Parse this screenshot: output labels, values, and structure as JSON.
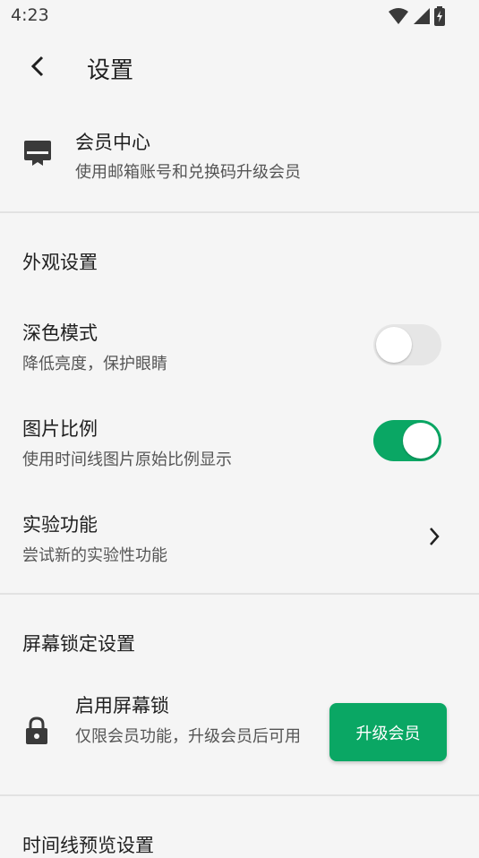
{
  "status_bar": {
    "time": "4:23"
  },
  "app_bar": {
    "title": "设置"
  },
  "member": {
    "title": "会员中心",
    "subtitle": "使用邮箱账号和兑换码升级会员"
  },
  "appearance": {
    "section_title": "外观设置",
    "dark_mode": {
      "title": "深色模式",
      "subtitle": "降低亮度，保护眼睛",
      "enabled": false
    },
    "image_ratio": {
      "title": "图片比例",
      "subtitle": "使用时间线图片原始比例显示",
      "enabled": true
    },
    "experimental": {
      "title": "实验功能",
      "subtitle": "尝试新的实验性功能"
    }
  },
  "screen_lock": {
    "section_title": "屏幕锁定设置",
    "title": "启用屏幕锁",
    "subtitle": "仅限会员功能，升级会员后可用",
    "button_label": "升级会员"
  },
  "timeline": {
    "section_title": "时间线预览设置"
  },
  "colors": {
    "accent": "#0aa764",
    "background": "#f5f5f5",
    "divider": "#e2e2e2"
  }
}
